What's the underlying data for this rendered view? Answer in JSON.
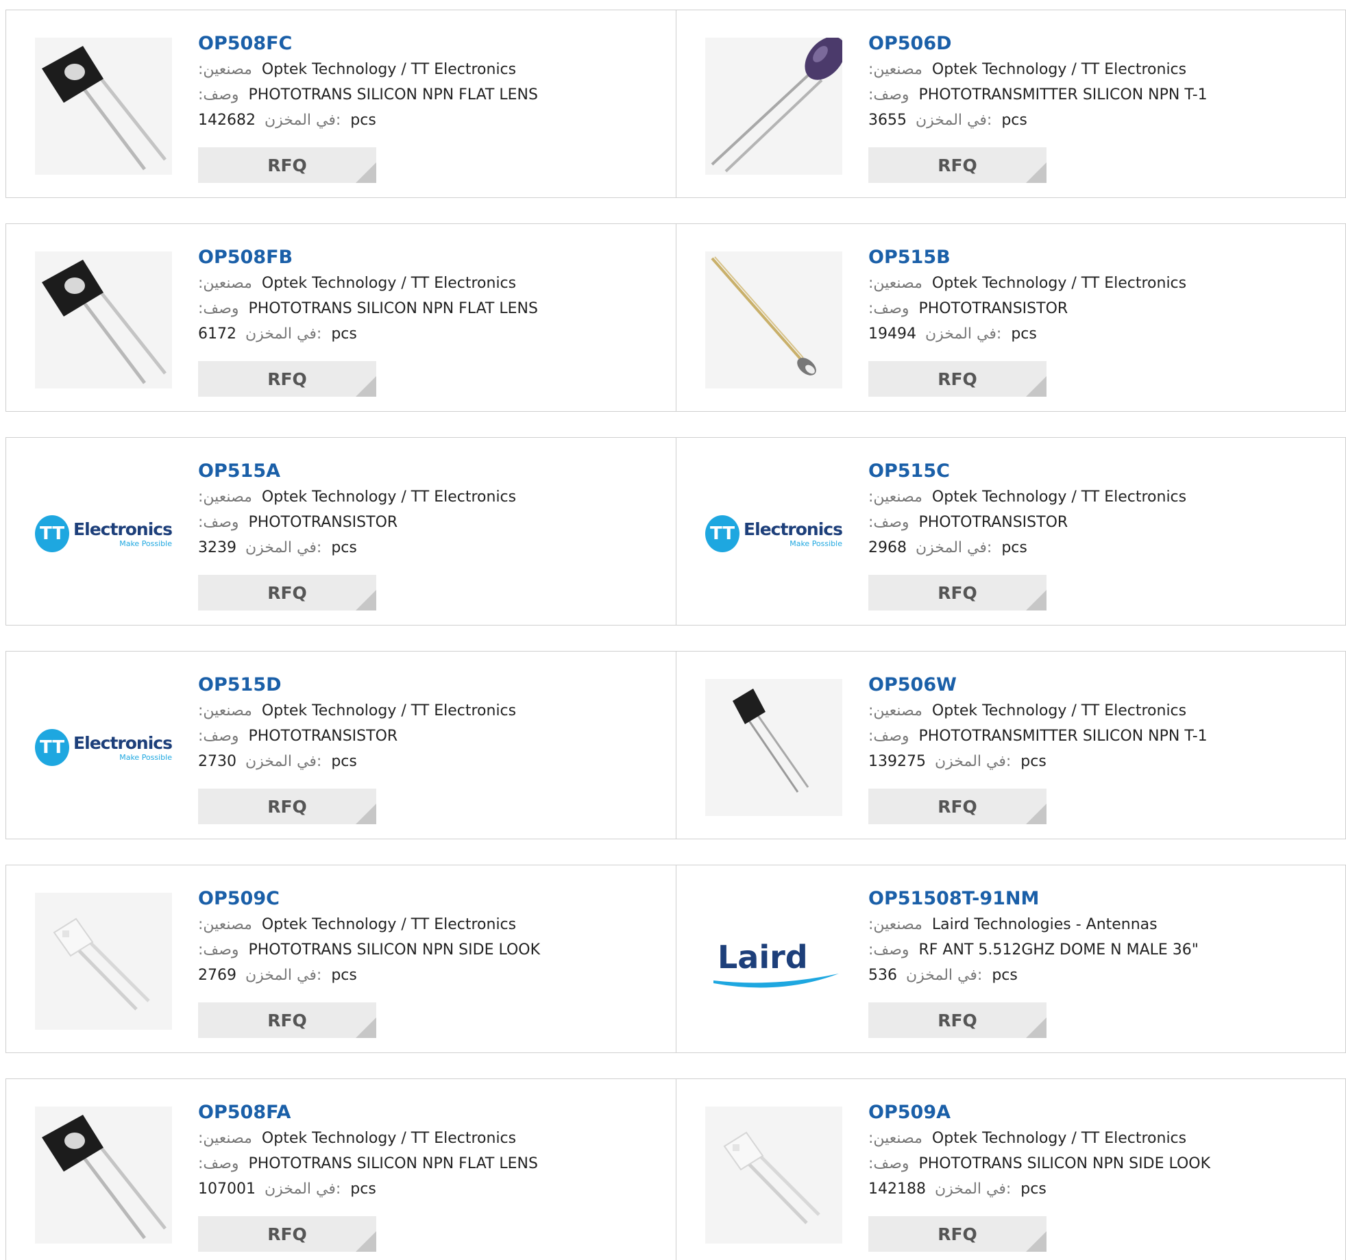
{
  "labels": {
    "manufacturer": ":مصنعين",
    "description": ":وصف",
    "stock": "في المخزن:",
    "unit": "pcs",
    "rfq": "RFQ"
  },
  "products": [
    {
      "part": "OP508FC",
      "manufacturer": "Optek Technology / TT Electronics",
      "description": "PHOTOTRANS SILICON NPN FLAT LENS",
      "stock": "142682",
      "image": "black-square-phototransistor-image"
    },
    {
      "part": "OP506D",
      "manufacturer": "Optek Technology / TT Electronics",
      "description": "PHOTOTRANSMITTER SILICON NPN T-1",
      "stock": "3655",
      "image": "purple-led-phototransmitter-image"
    },
    {
      "part": "OP508FB",
      "manufacturer": "Optek Technology / TT Electronics",
      "description": "PHOTOTRANS SILICON NPN FLAT LENS",
      "stock": "6172",
      "image": "black-square-phototransistor-image"
    },
    {
      "part": "OP515B",
      "manufacturer": "Optek Technology / TT Electronics",
      "description": "PHOTOTRANSISTOR",
      "stock": "19494",
      "image": "tiny-can-phototransistor-image"
    },
    {
      "part": "OP515A",
      "manufacturer": "Optek Technology / TT Electronics",
      "description": "PHOTOTRANSISTOR",
      "stock": "3239",
      "image": "tt-electronics-logo"
    },
    {
      "part": "OP515C",
      "manufacturer": "Optek Technology / TT Electronics",
      "description": "PHOTOTRANSISTOR",
      "stock": "2968",
      "image": "tt-electronics-logo"
    },
    {
      "part": "OP515D",
      "manufacturer": "Optek Technology / TT Electronics",
      "description": "PHOTOTRANSISTOR",
      "stock": "2730",
      "image": "tt-electronics-logo"
    },
    {
      "part": "OP506W",
      "manufacturer": "Optek Technology / TT Electronics",
      "description": "PHOTOTRANSMITTER SILICON NPN T-1",
      "stock": "139275",
      "image": "small-black-phototransmitter-image"
    },
    {
      "part": "OP509C",
      "manufacturer": "Optek Technology / TT Electronics",
      "description": "PHOTOTRANS SILICON NPN SIDE LOOK",
      "stock": "2769",
      "image": "white-side-look-phototransistor-image"
    },
    {
      "part": "OP51508T-91NM",
      "manufacturer": "Laird Technologies - Antennas",
      "description": "RF ANT 5.512GHZ DOME N MALE 36\"",
      "stock": "536",
      "image": "laird-logo"
    },
    {
      "part": "OP508FA",
      "manufacturer": "Optek Technology / TT Electronics",
      "description": "PHOTOTRANS SILICON NPN FLAT LENS",
      "stock": "107001",
      "image": "black-square-phototransistor-image"
    },
    {
      "part": "OP509A",
      "manufacturer": "Optek Technology / TT Electronics",
      "description": "PHOTOTRANS SILICON NPN SIDE LOOK",
      "stock": "142188",
      "image": "white-side-look-phototransistor-image"
    }
  ],
  "logos": {
    "tt_letters": "TT",
    "tt_word": "Electronics",
    "tt_tagline": "Make Possible",
    "laird_word": "Laird"
  },
  "colors": {
    "part_link": "#1a5fa8",
    "rfq_bg": "#ebebeb",
    "tt_blue": "#1ea7e0",
    "laird_blue": "#1d3f7a"
  }
}
